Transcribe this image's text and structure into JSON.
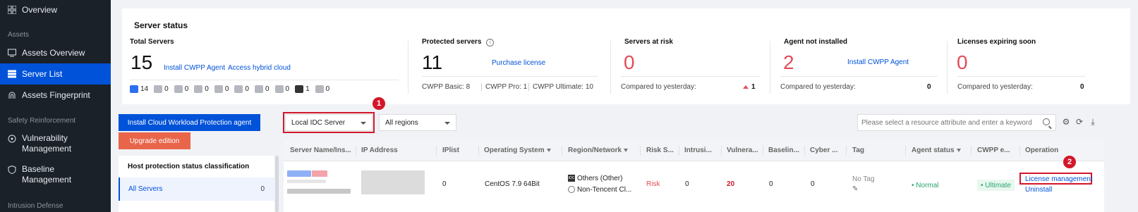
{
  "sidebar": {
    "overview": "Overview",
    "section_assets": "Assets",
    "assets_overview": "Assets Overview",
    "server_list": "Server List",
    "assets_fingerprint": "Assets Fingerprint",
    "section_safety": "Safety Reinforcement",
    "vuln_line1": "Vulnerability",
    "vuln_line2": "Management",
    "baseline_line1": "Baseline",
    "baseline_line2": "Management",
    "section_intrusion": "Intrusion Defense"
  },
  "status": {
    "title": "Server status",
    "total": {
      "label": "Total Servers",
      "value": "15",
      "link1": "Install CWPP Agent",
      "link2": "Access hybrid cloud",
      "os_counts": [
        "14",
        "0",
        "0",
        "0",
        "0",
        "0",
        "0",
        "0",
        "1",
        "0"
      ]
    },
    "protected": {
      "label": "Protected servers",
      "info_icon": "i",
      "value": "11",
      "link": "Purchase license",
      "basic": "CWPP Basic: 8",
      "pro": "CWPP Pro: 1",
      "ultimate": "CWPP Ultimate: 10"
    },
    "risk": {
      "label": "Servers at risk",
      "value": "0",
      "compare": "Compared to yesterday:",
      "delta": "1"
    },
    "agent": {
      "label": "Agent not installed",
      "value": "2",
      "link": "Install CWPP Agent",
      "compare": "Compared to yesterday:",
      "delta": "0"
    },
    "licenses": {
      "label": "Licenses expiring soon",
      "value": "0",
      "compare": "Compared to yesterday:",
      "delta": "0"
    }
  },
  "actions": {
    "install": "Install Cloud Workload Protection agent",
    "upgrade": "Upgrade edition"
  },
  "classification": {
    "title": "Host protection status classification",
    "all_label": "All Servers",
    "all_count": "0"
  },
  "filters": {
    "server_type": "Local IDC Server",
    "regions": "All regions",
    "search_placeholder": "Please select a resource attribute and enter a keyword",
    "badge1": "1",
    "badge2": "2"
  },
  "table": {
    "headers": {
      "name": "Server Name/Ins...",
      "ip": "IP Address",
      "iplist": "IPlist",
      "os": "Operating System",
      "region": "Region/Network",
      "risk": "Risk S...",
      "intrusion": "Intrusi...",
      "vuln": "Vulnera...",
      "baseline": "Baselin...",
      "cyber": "Cyber ...",
      "tag": "Tag",
      "agent": "Agent status",
      "cwpp": "CWPP e...",
      "operation": "Operation"
    },
    "row": {
      "iplist": "0",
      "os": "CentOS 7.9 64Bit",
      "region1": "Others (Other)",
      "region2": "Non-Tencent Cl...",
      "risk": "Risk",
      "intrusion": "0",
      "vuln": "20",
      "baseline": "0",
      "cyber": "0",
      "tag": "No Tag",
      "agent": "Normal",
      "cwpp": "Ultimate",
      "op1": "License management",
      "op2": "Uninstall"
    }
  },
  "colors": {
    "brand": "#0052d9",
    "danger": "#e34d59",
    "highlight": "#d3172a",
    "sidebar_bg": "#1b2129",
    "success": "#2ba471",
    "upgrade": "#e8654a"
  }
}
